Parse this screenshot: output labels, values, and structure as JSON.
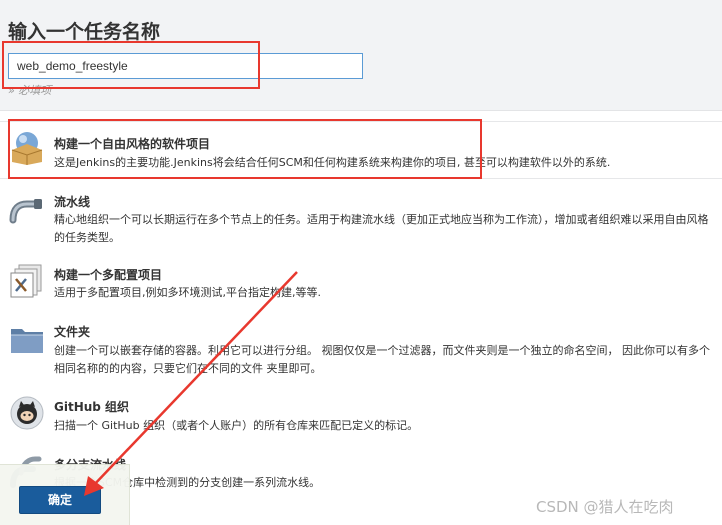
{
  "page": {
    "title": "输入一个任务名称",
    "task_name_value": "web_demo_freestyle",
    "required_hint": "» 必填项"
  },
  "items": [
    {
      "title": "构建一个自由风格的软件项目",
      "description": "这是Jenkins的主要功能.Jenkins将会结合任何SCM和任何构建系统来构建你的项目, 甚至可以构建软件以外的系统.",
      "icon": "freestyle-box-icon"
    },
    {
      "title": "流水线",
      "description": "精心地组织一个可以长期运行在多个节点上的任务。适用于构建流水线（更加正式地应当称为工作流），增加或者组织难以采用自由风格的任务类型。",
      "icon": "pipeline-icon"
    },
    {
      "title": "构建一个多配置项目",
      "description": "适用于多配置项目,例如多环境测试,平台指定构建,等等.",
      "icon": "multi-config-icon"
    },
    {
      "title": "文件夹",
      "description": "创建一个可以嵌套存储的容器。利用它可以进行分组。 视图仅仅是一个过滤器，而文件夹则是一个独立的命名空间， 因此你可以有多个相同名称的的内容，只要它们在不同的文件 夹里即可。",
      "icon": "folder-icon"
    },
    {
      "title": "GitHub 组织",
      "description": "扫描一个 GitHub 组织（或者个人账户）的所有仓库来匹配已定义的标记。",
      "icon": "github-icon"
    },
    {
      "title": "多分支流水线",
      "description": "根据一个SCM仓库中检测到的分支创建一系列流水线。",
      "icon": "multibranch-icon"
    }
  ],
  "footer": {
    "ok_label": "确定"
  },
  "watermark": "CSDN @猎人在吃肉",
  "colors": {
    "highlight": "#e8382e",
    "ok_button": "#1a5c9c",
    "input_border": "#5b9bd5"
  }
}
